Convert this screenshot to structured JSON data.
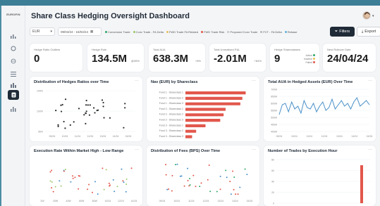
{
  "app": {
    "logo": "EUROFIN",
    "title": "Share Class Hedging Oversight Dashboard"
  },
  "sidebar": {
    "items": [
      {
        "name": "chart-icon",
        "active": false
      },
      {
        "name": "refresh-icon",
        "active": false
      },
      {
        "name": "globe-icon",
        "active": false
      },
      {
        "name": "list-icon",
        "active": false
      },
      {
        "name": "bar-icon",
        "active": false
      },
      {
        "name": "document-icon",
        "active": true
      },
      {
        "name": "stats-icon",
        "active": false
      }
    ]
  },
  "filters": {
    "currency": "EUR",
    "date_range": "09/04/24 - 15/04/24",
    "legend": [
      {
        "label": "Conversion Trade",
        "color": "#2ea866"
      },
      {
        "label": "Conv Trade - FA Delta",
        "color": "#9ec96e"
      },
      {
        "label": "FWD Trade FA Related",
        "color": "#e8c25a"
      },
      {
        "label": "FWD Trade Risk",
        "color": "#e2574c"
      },
      {
        "label": "Proposed Conv Trade",
        "color": "#c9c9c9"
      },
      {
        "label": "FCT - FA Delta",
        "color": "#b6b6b6"
      },
      {
        "label": "Rebase",
        "color": "#6ab0d8"
      }
    ],
    "filters_label": "Filters",
    "export_label": "Export"
  },
  "kpis": [
    {
      "label": "Hedge Ratio Outliers",
      "value": "0",
      "sub": ""
    },
    {
      "label": "Hedge Rule",
      "value": "134.5M",
      "sub": "@35%"
    },
    {
      "label": "Total AUA",
      "value": "638.3M",
      "sub": "+8%"
    },
    {
      "label": "Total Unrealised P&L",
      "value": "-2.01M",
      "sub": "+84%"
    },
    {
      "label": "Hedge Shareclasses",
      "value": "9",
      "side": [
        "Active",
        "Inactive",
        "Failed"
      ]
    },
    {
      "label": "Next Rollover Date",
      "value": "24/04/24",
      "sub": ""
    }
  ],
  "charts": {
    "ratios": {
      "title": "Distribution of Hedges Ratios over Time",
      "y_ticks": [
        "105%",
        "100%",
        "95%"
      ],
      "x_ticks": [
        "09/24",
        "10/24",
        "11/24",
        "12/24",
        "13/24",
        "14/24",
        "15/24"
      ]
    },
    "nav": {
      "title": "Nav (EUR) by Shareclass",
      "categories": [
        "Fund 1 - Shareclass 1",
        "Fund 1 - Shareclass 2",
        "Fund 1 - Shareclass 3",
        "Fund 2 - Shareclass 1",
        "Fund 2 - Shareclass 2",
        "Fund 2 - Shareclass 3",
        "Fund 3 - Shareclass 1",
        "Fund 3 - Shareclass 2",
        "Fund 3 - Shareclass 3"
      ],
      "values": [
        90,
        85,
        82,
        60,
        57,
        52,
        30,
        16,
        10
      ],
      "x_ticks": [
        "0",
        "50M",
        "100M",
        "150M"
      ]
    },
    "aua": {
      "title": "Total AUA in Hedged Assets (EUR) Over Time",
      "y_ticks": [
        "700M",
        "650M",
        "600M",
        "550M",
        "500M",
        "450M",
        "400M"
      ],
      "x_ticks": [
        "09/24",
        "10/24",
        "11/24",
        "12/24",
        "13/24",
        "14/24",
        "15/24"
      ],
      "values": [
        520,
        590,
        600,
        540,
        610,
        560,
        580,
        530,
        620,
        570,
        560,
        600,
        540,
        580,
        610,
        550,
        570,
        630,
        560,
        590,
        620,
        580,
        600,
        560,
        610,
        640,
        580,
        600,
        620,
        590
      ]
    },
    "execution": {
      "title": "Execution Rate Within Market High - Low Range",
      "x_ticks": [
        "2W",
        "20W",
        "40W",
        "60W",
        "80W",
        "10/24",
        "12/24",
        "14/24"
      ]
    },
    "fees": {
      "title": "Distribution of Fees (BPS) Over Time",
      "x_ticks": [
        "09/24",
        "10/24",
        "11/24",
        "12/24",
        "13/24",
        "14/24",
        "15/24"
      ]
    },
    "trades": {
      "title": "Number of Trades by Execution Hour",
      "y_ticks": [
        "80",
        "60",
        "40",
        "20",
        "0"
      ]
    }
  }
}
